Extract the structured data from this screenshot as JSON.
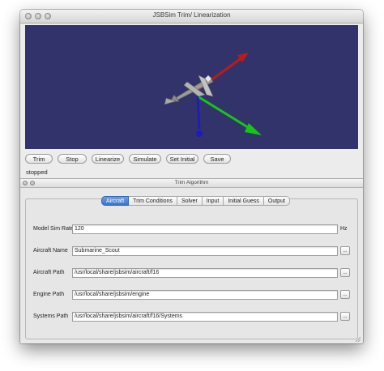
{
  "window": {
    "title": "JSBSim Trim/ Linearization",
    "status_text": "stopped"
  },
  "toolbar": {
    "buttons": [
      "Trim",
      "Stop",
      "Linearize",
      "Simulate",
      "Set Initial",
      "Save"
    ]
  },
  "viewport": {
    "background": "#33336b",
    "axis_colors": {
      "x": "#b81c1c",
      "y": "#16c516",
      "z": "#1c1cc0"
    }
  },
  "trim_panel": {
    "title": "Trim Algorithm",
    "tabs": [
      "Aircraft",
      "Trim Conditions",
      "Solver",
      "Input",
      "Initial Guess",
      "Output"
    ],
    "active_tab": "Aircraft",
    "fields": [
      {
        "label": "Model Sim Rate",
        "value": "120",
        "unit": "Hz"
      },
      {
        "label": "Aircraft Name",
        "value": "Submarine_Scout",
        "browse": "..."
      },
      {
        "label": "Aircraft Path",
        "value": "/usr/local/share/jsbsim/aircraft/f16",
        "browse": "..."
      },
      {
        "label": "Engine Path",
        "value": "/usr/local/share/jsbsim/engine",
        "browse": "..."
      },
      {
        "label": "Systems Path",
        "value": "/usr/local/share/jsbsim/aircraft/f16/Systems",
        "browse": "..."
      }
    ]
  }
}
